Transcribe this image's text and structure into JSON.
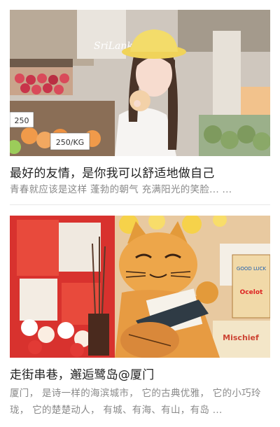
{
  "feed": {
    "items": [
      {
        "title": "最好的友情，是你我可以舒适地做自己",
        "summary": "青春就应该是这样 蓬勃的朝气 充满阳光的笑脸... ...",
        "image": {
          "watermark": "SriLanka",
          "price_tag_1": "250",
          "price_tag_2": "250/KG"
        }
      },
      {
        "title": "走街串巷，邂逅鹭岛@厦门",
        "summary": "厦门， 是诗一样的海滨城市， 它的古典优雅， 它的小巧玲珑， 它的楚楚动人， 有城、有海、有山，有岛 ...",
        "image": {
          "box_label_1": "GOOD LUCK",
          "box_label_2": "Ocelot",
          "box_label_3": "Mischief"
        }
      }
    ]
  }
}
